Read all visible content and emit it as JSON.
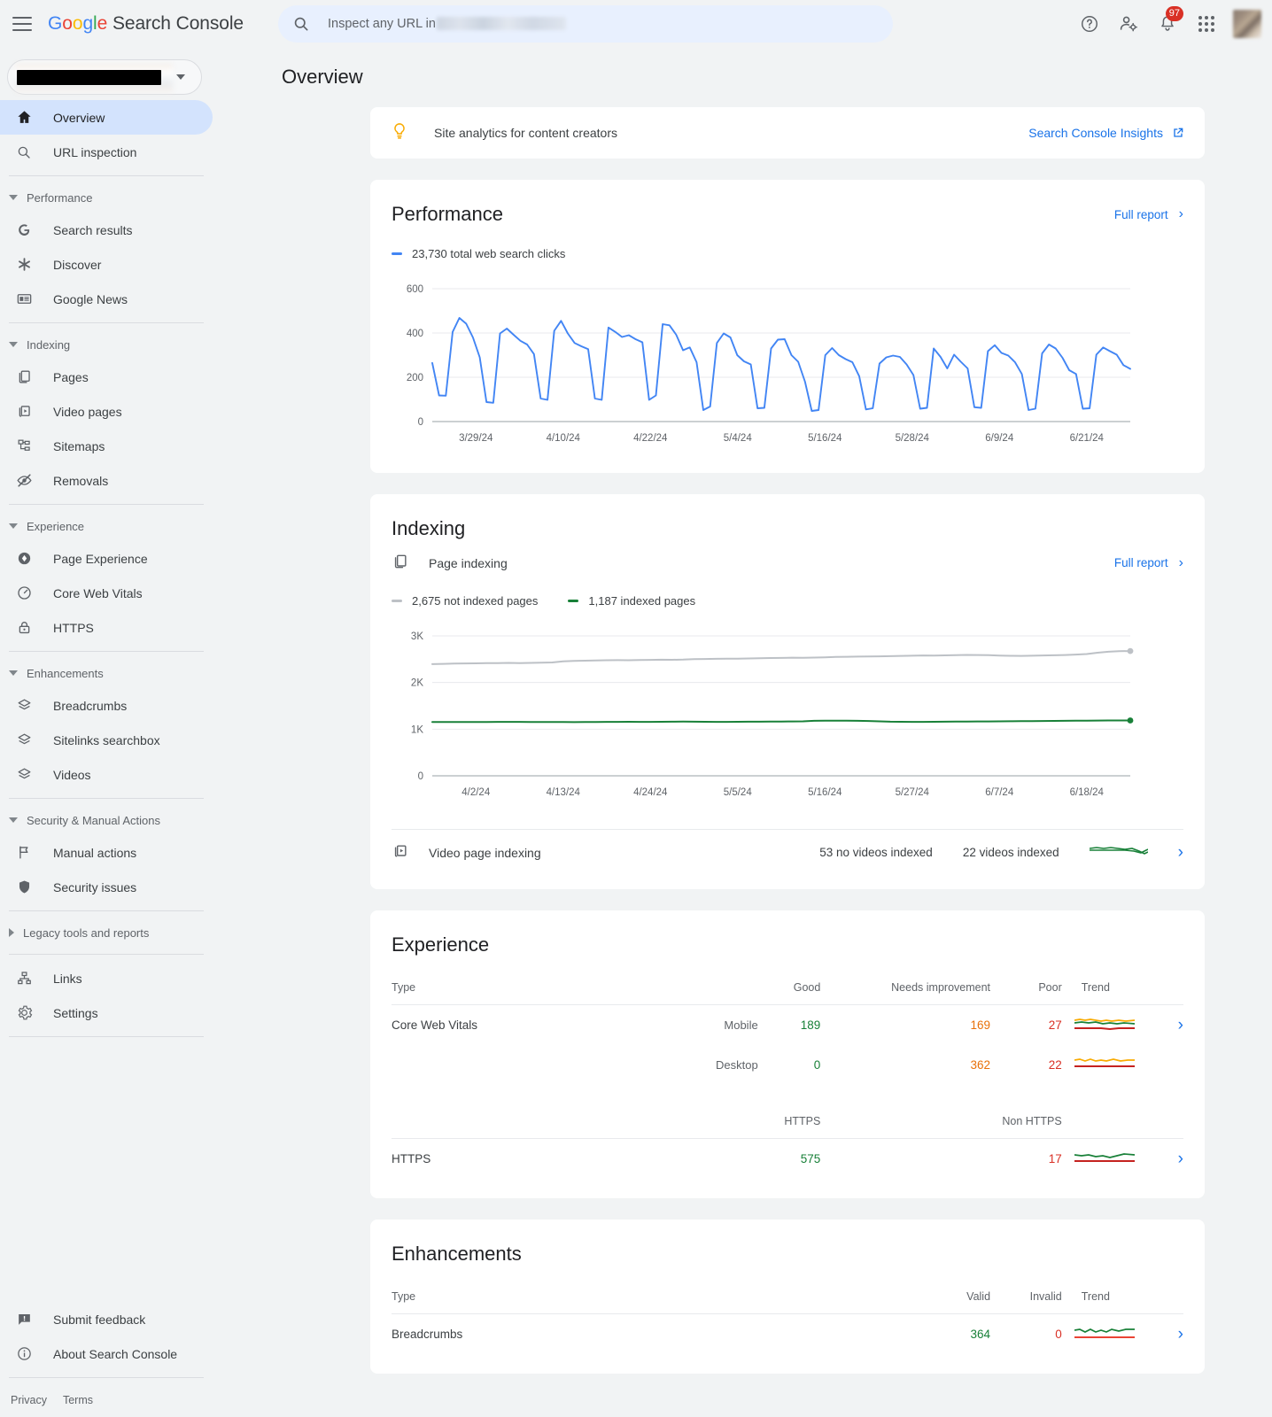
{
  "header": {
    "brand_google": "Google",
    "brand_product": "Search Console",
    "search_placeholder": "Inspect any URL in",
    "notification_count": "97",
    "icons": [
      "hamburger-icon",
      "search-icon",
      "help-icon",
      "account-settings-icon",
      "notifications-icon",
      "apps-grid-icon",
      "avatar"
    ]
  },
  "sidebar": {
    "property_selector": "",
    "items": [
      {
        "label": "Overview",
        "icon": "home-icon",
        "active": true
      },
      {
        "label": "URL inspection",
        "icon": "search-icon",
        "active": false
      }
    ],
    "groups": [
      {
        "title": "Performance",
        "expanded": true,
        "items": [
          {
            "label": "Search results",
            "icon": "google-g-icon"
          },
          {
            "label": "Discover",
            "icon": "discover-asterisk-icon"
          },
          {
            "label": "Google News",
            "icon": "google-news-icon"
          }
        ]
      },
      {
        "title": "Indexing",
        "expanded": true,
        "items": [
          {
            "label": "Pages",
            "icon": "pages-icon"
          },
          {
            "label": "Video pages",
            "icon": "video-pages-icon"
          },
          {
            "label": "Sitemaps",
            "icon": "sitemaps-icon"
          },
          {
            "label": "Removals",
            "icon": "removals-eye-off-icon"
          }
        ]
      },
      {
        "title": "Experience",
        "expanded": true,
        "items": [
          {
            "label": "Page Experience",
            "icon": "page-experience-icon"
          },
          {
            "label": "Core Web Vitals",
            "icon": "core-web-vitals-gauge-icon"
          },
          {
            "label": "HTTPS",
            "icon": "lock-icon"
          }
        ]
      },
      {
        "title": "Enhancements",
        "expanded": true,
        "items": [
          {
            "label": "Breadcrumbs",
            "icon": "layers-icon"
          },
          {
            "label": "Sitelinks searchbox",
            "icon": "layers-icon"
          },
          {
            "label": "Videos",
            "icon": "layers-icon"
          }
        ]
      },
      {
        "title": "Security & Manual Actions",
        "expanded": true,
        "items": [
          {
            "label": "Manual actions",
            "icon": "flag-icon"
          },
          {
            "label": "Security issues",
            "icon": "shield-icon"
          }
        ]
      },
      {
        "title": "Legacy tools and reports",
        "expanded": false,
        "items": []
      }
    ],
    "bottom_items": [
      {
        "label": "Links",
        "icon": "links-icon"
      },
      {
        "label": "Settings",
        "icon": "gear-icon"
      }
    ],
    "footer_items": [
      {
        "label": "Submit feedback",
        "icon": "feedback-icon"
      },
      {
        "label": "About Search Console",
        "icon": "info-icon"
      }
    ],
    "legal": [
      "Privacy",
      "Terms"
    ]
  },
  "page": {
    "title": "Overview"
  },
  "banner": {
    "text": "Site analytics for content creators",
    "link": "Search Console Insights",
    "icon": "lightbulb-icon",
    "external_icon": "external-link-icon"
  },
  "performance": {
    "title": "Performance",
    "full_report": "Full report",
    "legend": "23,730 total web search clicks"
  },
  "indexing": {
    "title": "Indexing",
    "page_indexing_label": "Page indexing",
    "full_report": "Full report",
    "legend_not_indexed": "2,675 not indexed pages",
    "legend_indexed": "1,187 indexed pages",
    "video_row": {
      "label": "Video page indexing",
      "stat_left": "53 no videos indexed",
      "stat_right": "22 videos indexed"
    }
  },
  "experience": {
    "title": "Experience",
    "columns": [
      "Type",
      "",
      "Good",
      "Needs improvement",
      "Poor",
      "Trend"
    ],
    "cwv": {
      "type": "Core Web Vitals",
      "rows": [
        {
          "device": "Mobile",
          "good": "189",
          "needs": "169",
          "poor": "27"
        },
        {
          "device": "Desktop",
          "good": "0",
          "needs": "362",
          "poor": "22"
        }
      ]
    },
    "https": {
      "columns": [
        "HTTPS",
        "Non HTTPS"
      ],
      "type": "HTTPS",
      "https_count": "575",
      "non_https_count": "17"
    }
  },
  "enhancements": {
    "title": "Enhancements",
    "columns": [
      "Type",
      "Valid",
      "Invalid",
      "Trend"
    ],
    "rows": [
      {
        "type": "Breadcrumbs",
        "valid": "364",
        "invalid": "0"
      }
    ]
  },
  "colors": {
    "blue": "#1a73e8",
    "chart_blue": "#4285f4",
    "green": "#188038",
    "gray_line": "#bdc1c6",
    "orange": "#e8710a",
    "red": "#d93025",
    "accent_bg": "#d3e3fd"
  },
  "chart_data": [
    {
      "type": "line",
      "title": "Performance",
      "ylabel": "",
      "xlabel": "",
      "ylim": [
        0,
        600
      ],
      "yticks": [
        0,
        200,
        400,
        600
      ],
      "xticks": [
        "3/29/24",
        "4/10/24",
        "4/22/24",
        "5/4/24",
        "5/16/24",
        "5/28/24",
        "6/9/24",
        "6/21/24"
      ],
      "grid": true,
      "legend": [
        "23,730 total web search clicks"
      ],
      "series": [
        {
          "name": "total web search clicks",
          "color": "#4285f4",
          "values": [
            265,
            118,
            117,
            405,
            468,
            442,
            380,
            290,
            88,
            85,
            398,
            420,
            392,
            365,
            348,
            305,
            104,
            98,
            410,
            455,
            398,
            355,
            340,
            327,
            104,
            98,
            425,
            405,
            382,
            390,
            372,
            358,
            98,
            118,
            440,
            435,
            392,
            322,
            335,
            268,
            52,
            68,
            355,
            398,
            380,
            300,
            272,
            258,
            60,
            62,
            330,
            370,
            372,
            300,
            270,
            180,
            48,
            52,
            300,
            332,
            300,
            282,
            268,
            205,
            55,
            60,
            262,
            290,
            298,
            292,
            258,
            210,
            58,
            62,
            330,
            292,
            240,
            302,
            270,
            240,
            65,
            62,
            318,
            345,
            310,
            298,
            268,
            215,
            52,
            58,
            308,
            348,
            330,
            288,
            232,
            215,
            58,
            60,
            302,
            335,
            318,
            302,
            255,
            238
          ]
        }
      ]
    },
    {
      "type": "line",
      "title": "Page indexing",
      "ylim": [
        0,
        3000
      ],
      "yticks": [
        "0",
        "1K",
        "2K",
        "3K"
      ],
      "xticks": [
        "4/2/24",
        "4/13/24",
        "4/24/24",
        "5/5/24",
        "5/16/24",
        "5/27/24",
        "6/7/24",
        "6/18/24"
      ],
      "grid": true,
      "legend": [
        "2,675 not indexed pages",
        "1,187 indexed pages"
      ],
      "series": [
        {
          "name": "not indexed pages",
          "color": "#bdc1c6",
          "values": [
            2395,
            2400,
            2405,
            2410,
            2412,
            2415,
            2418,
            2420,
            2418,
            2420,
            2425,
            2430,
            2455,
            2462,
            2468,
            2472,
            2478,
            2480,
            2478,
            2482,
            2485,
            2490,
            2488,
            2492,
            2500,
            2505,
            2508,
            2512,
            2510,
            2515,
            2520,
            2525,
            2528,
            2532,
            2530,
            2535,
            2540,
            2548,
            2552,
            2556,
            2560,
            2562,
            2566,
            2570,
            2575,
            2580,
            2578,
            2582,
            2588,
            2592,
            2590,
            2586,
            2578,
            2572,
            2570,
            2575,
            2580,
            2585,
            2590,
            2600,
            2610,
            2640,
            2660,
            2672,
            2675
          ]
        },
        {
          "name": "indexed pages",
          "color": "#188038",
          "values": [
            1152,
            1153,
            1153,
            1154,
            1155,
            1155,
            1156,
            1156,
            1157,
            1155,
            1154,
            1153,
            1152,
            1150,
            1152,
            1155,
            1156,
            1157,
            1158,
            1157,
            1156,
            1158,
            1160,
            1162,
            1160,
            1158,
            1157,
            1156,
            1158,
            1160,
            1161,
            1162,
            1163,
            1165,
            1168,
            1180,
            1182,
            1183,
            1182,
            1180,
            1176,
            1168,
            1160,
            1158,
            1157,
            1156,
            1158,
            1160,
            1162,
            1163,
            1165,
            1166,
            1168,
            1170,
            1172,
            1174,
            1176,
            1178,
            1180,
            1182,
            1183,
            1185,
            1186,
            1187,
            1187
          ]
        }
      ]
    }
  ]
}
